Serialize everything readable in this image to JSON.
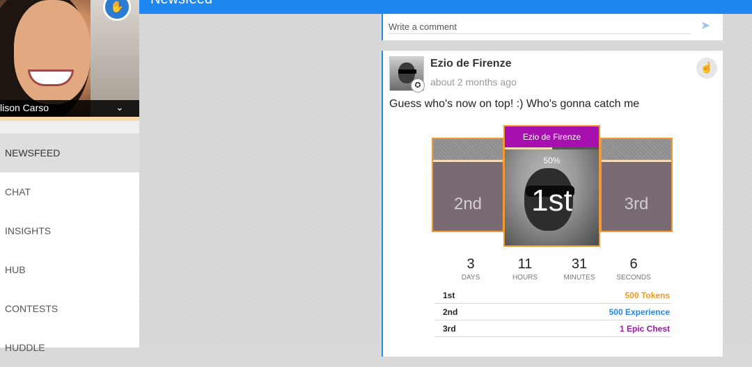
{
  "header": {
    "title": "Newsfeed"
  },
  "profile": {
    "name": "lison Carso"
  },
  "nav": [
    {
      "label": "NEWSFEED",
      "active": true
    },
    {
      "label": "CHAT"
    },
    {
      "label": "INSIGHTS"
    },
    {
      "label": "HUB"
    },
    {
      "label": "CONTESTS"
    },
    {
      "label": "HUDDLE"
    }
  ],
  "comment": {
    "placeholder": "Write a comment"
  },
  "post": {
    "author": "Ezio de Firenze",
    "time": "about 2 months ago",
    "text": "Guess who's now on top! :) Who's gonna catch me"
  },
  "podium": {
    "first_name": "Ezio de Firenze",
    "progress_label": "50%",
    "progress_value": 0.5,
    "first": "1st",
    "second": "2nd",
    "third": "3rd"
  },
  "countdown": [
    {
      "value": "3",
      "label": "DAYS"
    },
    {
      "value": "11",
      "label": "HOURS"
    },
    {
      "value": "31",
      "label": "MINUTES"
    },
    {
      "value": "6",
      "label": "SECONDS"
    }
  ],
  "rewards": [
    {
      "place": "1st",
      "reward": "500 Tokens",
      "color": "#f29a1b"
    },
    {
      "place": "2nd",
      "reward": "500 Experience",
      "color": "#1f88f0"
    },
    {
      "place": "3rd",
      "reward": "1 Epic Chest",
      "color": "#a70fae"
    }
  ],
  "colors": {
    "primary": "#1f88f0",
    "accent": "#f29a33",
    "purple": "#a70fae"
  }
}
